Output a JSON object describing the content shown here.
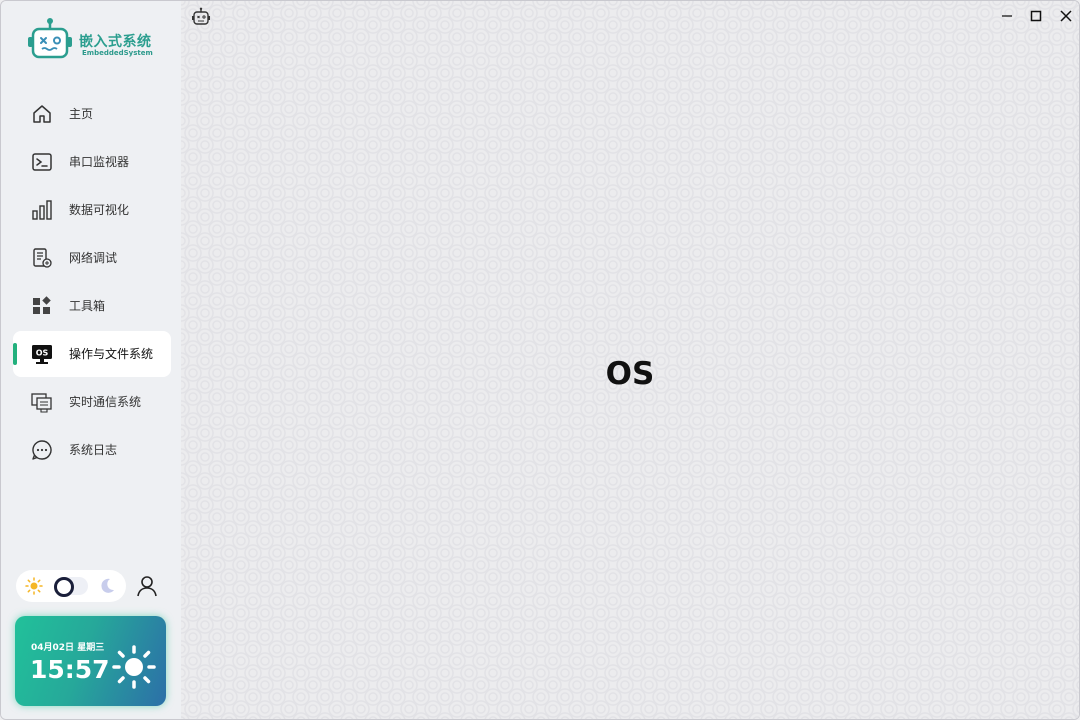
{
  "app": {
    "title_cn": "嵌入式系统",
    "title_en": "EmbeddedSystem"
  },
  "sidebar": {
    "items": [
      {
        "label": "主页",
        "icon": "home-icon"
      },
      {
        "label": "串口监视器",
        "icon": "terminal-icon"
      },
      {
        "label": "数据可视化",
        "icon": "bar-chart-icon"
      },
      {
        "label": "网络调试",
        "icon": "network-document-icon"
      },
      {
        "label": "工具箱",
        "icon": "toolbox-grid-icon"
      },
      {
        "label": "操作与文件系统",
        "icon": "os-monitor-icon",
        "active": true,
        "badge": "OS"
      },
      {
        "label": "实时通信系统",
        "icon": "realtime-comm-icon"
      },
      {
        "label": "系统日志",
        "icon": "chat-log-icon"
      }
    ],
    "theme_toggle": {
      "mode": "light"
    },
    "datetime": {
      "date": "04月02日",
      "weekday": "星期三",
      "time": "15:57"
    }
  },
  "main": {
    "content_text": "OS"
  },
  "colors": {
    "accent": "#22b07d",
    "brand": "#2b9e8f",
    "card_start": "#21c19a",
    "card_end": "#2c6fa8"
  }
}
